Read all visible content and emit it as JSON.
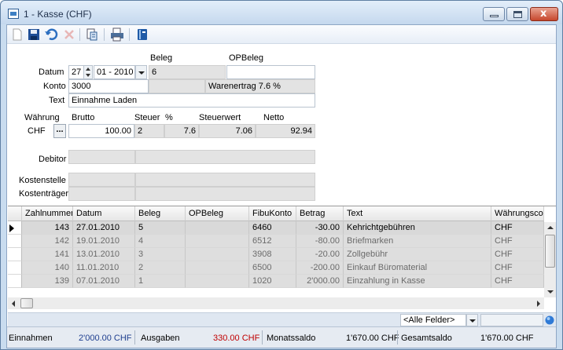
{
  "window": {
    "title": "1 - Kasse (CHF)"
  },
  "toolbar": {
    "buttons": [
      "new-icon",
      "save-icon",
      "undo-icon",
      "delete-icon",
      "copy-document-icon",
      "print-icon",
      "book-icon"
    ]
  },
  "form": {
    "beleg_header": "Beleg",
    "opbeleg_header": "OPBeleg",
    "datum_label": "Datum",
    "datum_day": "27",
    "datum_month_year": "01 - 2010",
    "beleg_value": "6",
    "opbeleg_value": "",
    "konto_label": "Konto",
    "konto_value": "3000",
    "konto_desc": "",
    "konto_name": "Warenertrag 7.6 %",
    "text_label": "Text",
    "text_value": "Einnahme Laden",
    "waehrung_label": "Währung",
    "brutto_label": "Brutto",
    "steuer_label": "Steuer",
    "percent_label": "%",
    "steuerwert_label": "Steuerwert",
    "netto_label": "Netto",
    "waehrung_value": "CHF",
    "ellipsis": "...",
    "brutto_value": "100.00",
    "steuer_value": "2",
    "percent_value": "7.6",
    "steuerwert_value": "7.06",
    "netto_value": "92.94",
    "debitor_label": "Debitor",
    "kostenstelle_label": "Kostenstelle",
    "kostentraeger_label": "Kostenträger"
  },
  "table": {
    "columns": [
      "Zahlnummer",
      "Datum",
      "Beleg",
      "OPBeleg",
      "FibuKonto",
      "Betrag",
      "Text",
      "Währungsco"
    ],
    "rows": [
      [
        "143",
        "27.01.2010",
        "5",
        "",
        "6460",
        "-30.00",
        "Kehrichtgebühren",
        "CHF"
      ],
      [
        "142",
        "19.01.2010",
        "4",
        "",
        "6512",
        "-80.00",
        "Briefmarken",
        "CHF"
      ],
      [
        "141",
        "13.01.2010",
        "3",
        "",
        "3908",
        "-20.00",
        "Zollgebühr",
        "CHF"
      ],
      [
        "140",
        "11.01.2010",
        "2",
        "",
        "6500",
        "-200.00",
        "Einkauf Büromaterial",
        "CHF"
      ],
      [
        "139",
        "07.01.2010",
        "1",
        "",
        "1020",
        "2'000.00",
        "Einzahlung in Kasse",
        "CHF"
      ]
    ]
  },
  "filter": {
    "selected": "<Alle Felder>"
  },
  "status": {
    "einnahmen_label": "Einnahmen",
    "einnahmen_value": "2'000.00 CHF",
    "ausgaben_label": "Ausgaben",
    "ausgaben_value": "330.00 CHF",
    "monatssaldo_label": "Monatssaldo",
    "monatssaldo_value": "1'670.00 CHF",
    "gesamtsaldo_label": "Gesamtsaldo",
    "gesamtsaldo_value": "1'670.00 CHF"
  },
  "colors": {
    "accent": "#2d5d94",
    "ausgaben": "#c00000",
    "einnahmen": "#1f3f8f"
  }
}
